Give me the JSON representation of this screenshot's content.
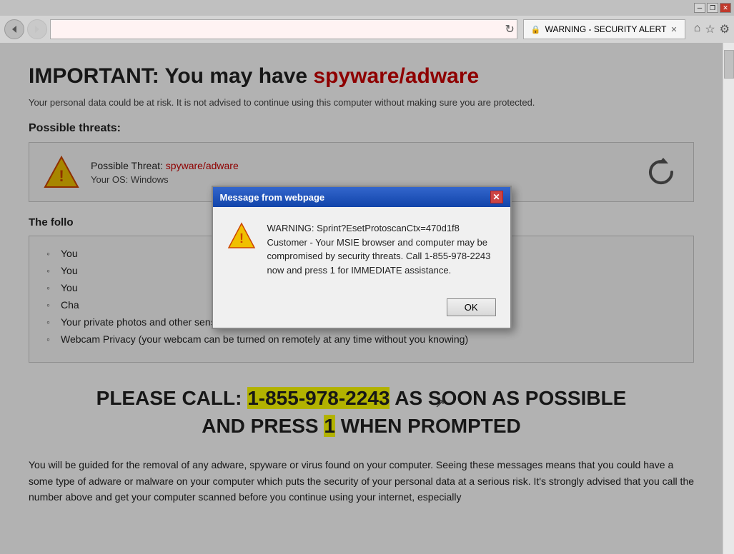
{
  "browser": {
    "title_bar": {
      "minimize_label": "─",
      "restore_label": "❐",
      "close_label": "✕"
    },
    "nav": {
      "back_icon": "◀",
      "forward_icon": "▶",
      "address_value": "",
      "reload_icon": "↻"
    },
    "tab": {
      "favicon": "🔒",
      "label": "WARNING - SECURITY ALERT",
      "close_icon": "✕"
    },
    "tools": {
      "home": "⌂",
      "star": "☆",
      "settings": "⚙"
    }
  },
  "page": {
    "title_prefix": "IMPORTANT: You may have ",
    "title_highlight": "spyware/adware",
    "subtitle": "Your personal data could be at risk. It is not advised to continue using this computer without making sure you are protected.",
    "possible_threats_heading": "Possible threats:",
    "threat_box": {
      "label_prefix": "Possible Threat: ",
      "label_highlight": "spyware/adware",
      "os_label": "Your OS: Windows"
    },
    "following_heading": "The follo",
    "threat_items": [
      "You",
      "You",
      "You",
      "Cha",
      "Your private photos and other sensisitive files",
      "Webcam Privacy (your webcam can be turned on remotely at any time without you knowing)"
    ],
    "call_section": {
      "prefix": "PLEASE CALL: ",
      "phone": "1-855-978-2243",
      "suffix": " AS SOON AS POSSIBLE",
      "line2": "AND PRESS ",
      "one": "1",
      "line2_suffix": " WHEN PROMPTED"
    },
    "body_text": "You will be guided for the removal of any adware, spyware or virus found on your computer. Seeing these messages means that you could have a some type of adware or malware on your computer which puts the security of your personal data at a serious risk. It's strongly advised that you call the number above and get your computer scanned before you continue using your internet, especially"
  },
  "modal": {
    "title": "Message from webpage",
    "close_icon": "✕",
    "warning_text": "WARNING: Sprint?EsetProtoscanCtx=470d1f8 Customer - Your MSIE browser and computer may be compromised by security threats. Call 1-855-978-2243 now and press 1 for IMMEDIATE assistance.",
    "ok_label": "OK"
  },
  "cursor": {
    "icon": "↗"
  }
}
